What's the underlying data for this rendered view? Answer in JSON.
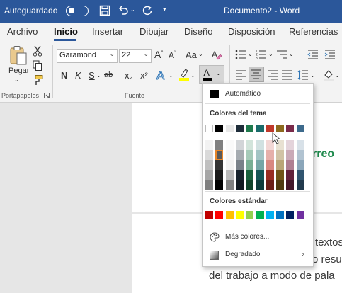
{
  "titlebar": {
    "autosave_label": "Autoguardado",
    "autosave_state": "Desactivado",
    "doc_title": "Documento2 - Word"
  },
  "tabs": [
    "Archivo",
    "Inicio",
    "Insertar",
    "Dibujar",
    "Diseño",
    "Disposición",
    "Referencias"
  ],
  "ribbon": {
    "clipboard": {
      "paste_label": "Pegar",
      "group_label": "Portapapeles"
    },
    "font": {
      "font_name": "Garamond",
      "font_size": "22",
      "group_label": "Fuente",
      "buttons": [
        "N",
        "K",
        "S",
        "ab",
        "x₂",
        "x²"
      ],
      "case_label": "Aa"
    }
  },
  "document": {
    "heading_fragment": "rreo",
    "line1": "textos",
    "line2": "o resum",
    "line3": "del trabajo a modo de pala"
  },
  "color_popup": {
    "automatic_label": "Automático",
    "theme_header": "Colores del tema",
    "standard_header": "Colores estándar",
    "more_colors_label": "Más colores...",
    "gradient_label": "Degradado",
    "theme_colors": [
      "#FFFFFF",
      "#000000",
      "#E7E6E6",
      "#44546A",
      "#4472C4",
      "#ED7D31",
      "#A5A5A5",
      "#FFC000",
      "#5B9BD5",
      "#70AD47"
    ],
    "theme_colors_shown": [
      "#FFFFFF",
      "#000000",
      "#E8E8E8",
      "#1F2D3A",
      "#1F7A4D",
      "#1A6B6B",
      "#C0392B",
      "#8C6A1E",
      "#7A2A4A",
      "#3D6A8C"
    ],
    "standard_colors": [
      "#C00000",
      "#FF0000",
      "#FFC000",
      "#FFFF00",
      "#92D050",
      "#00B050",
      "#00B0F0",
      "#0070C0",
      "#002060",
      "#7030A0"
    ]
  }
}
